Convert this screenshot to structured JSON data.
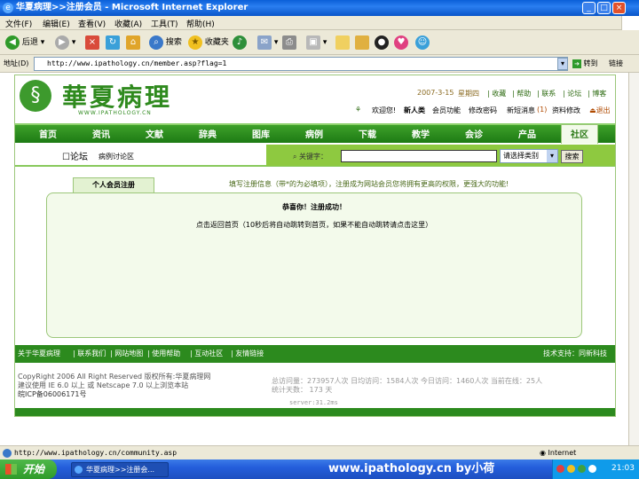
{
  "window": {
    "title": "华夏病理>>注册会员 - Microsoft Internet Explorer",
    "min": "_",
    "max": "□",
    "close": "×"
  },
  "menu": {
    "file": "文件(F)",
    "edit": "编辑(E)",
    "view": "查看(V)",
    "favorites": "收藏(A)",
    "tools": "工具(T)",
    "help": "帮助(H)"
  },
  "toolbar": {
    "back": "后退",
    "search": "搜索",
    "favorites": "收藏夹"
  },
  "address": {
    "label": "地址(D)",
    "url": "http://www.ipathology.cn/member.asp?flag=1",
    "go": "转到",
    "links": "链接"
  },
  "site": {
    "logo_text": "華夏病理",
    "logo_sub": "WWW.IPATHOLOGY.CN",
    "date": "2007-3-15",
    "weekday": "星期四",
    "top_links": [
      "收藏",
      "帮助",
      "联系",
      "论坛",
      "博客"
    ],
    "welcome": "欢迎您!",
    "username": "新人类",
    "user_links": [
      "会员功能",
      "修改密码",
      "新短消息",
      "资料修改",
      "退出"
    ],
    "new_msg_count": "(1)",
    "nav": [
      "首页",
      "资讯",
      "文献",
      "辞典",
      "图库",
      "病例",
      "下载",
      "教学",
      "会诊",
      "产品",
      "社区"
    ],
    "forum_title": "论坛",
    "forum_sub": "病例讨论区",
    "search_label": "关键字：",
    "search_value": "",
    "search_select": "请选择类别",
    "search_btn": "搜索",
    "tab_label": "个人会员注册",
    "notice": "填写注册信息（带*的为必填项），注册成为网站会员您将拥有更高的权限，更强大的功能!",
    "success_title": "恭喜你！注册成功！",
    "success_msg": "点击返回首页（10秒后将自动跳转到首页，如果不能自动跳转请点击这里）",
    "footer_links": [
      "关于华夏病理",
      "联系我们",
      "网站地图",
      "使用帮助",
      "互动社区",
      "友情链接"
    ],
    "tech_support": "技术支持：同新科技",
    "copyright": "CopyRight 2006 All Right Reserved 版权所有:华夏病理网",
    "browser_note": "建议使用 IE 6.0 以上 或 Netscape 7.0 以上浏览本站",
    "icp": "皖ICP备06006171号",
    "stats_line1": "总访问量：273957人次  日均访问：1584人次  今日访问：1460人次  当前在线：25人",
    "stats_line2": "统计天数： 173 天",
    "server": "server:31.2ms"
  },
  "status": {
    "url": "http://www.ipathology.cn/community.asp",
    "zone": "Internet"
  },
  "taskbar": {
    "start": "开始",
    "task": "华夏病理>>注册会...",
    "watermark": "www.ipathology.cn  by小荷",
    "clock": "21:03"
  }
}
